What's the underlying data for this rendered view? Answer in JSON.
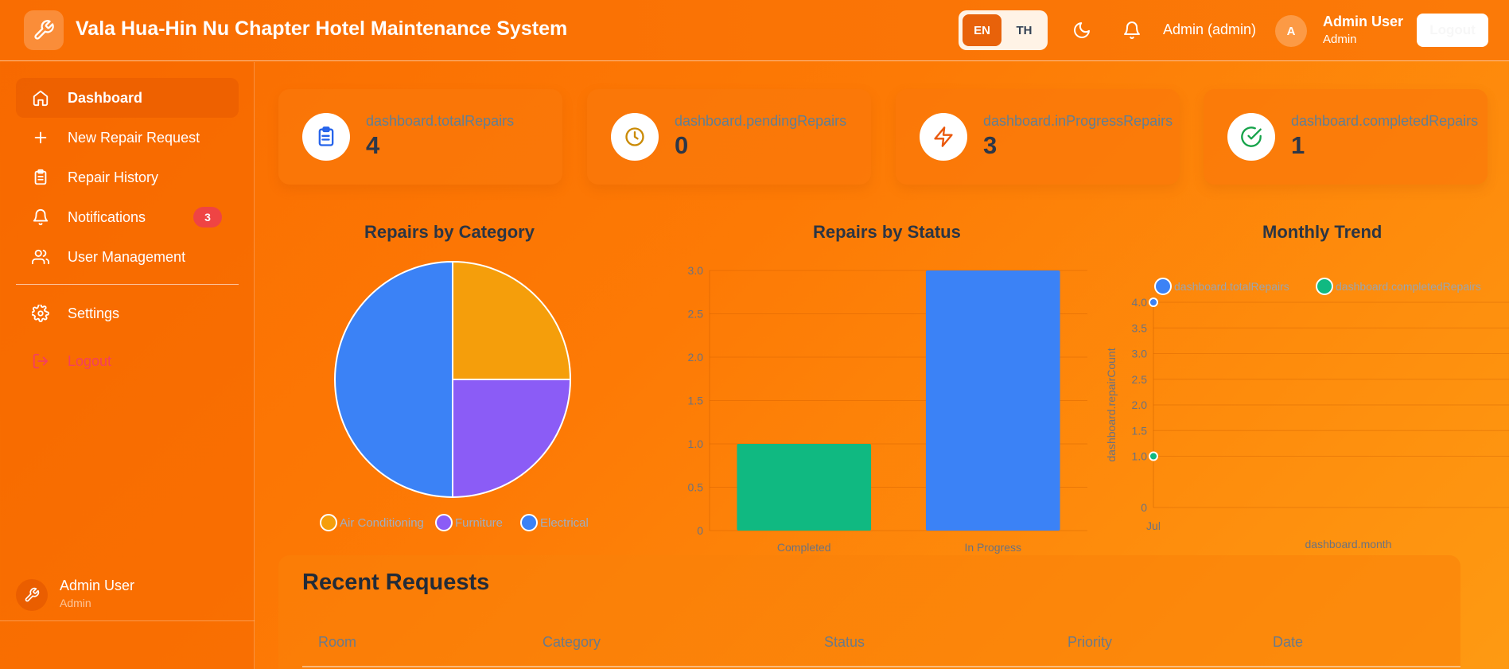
{
  "header": {
    "title": "Vala Hua-Hin Nu Chapter Hotel Maintenance System",
    "lang_en": "EN",
    "lang_th": "TH",
    "role_label": "Admin (admin)",
    "avatar_initial": "A",
    "user_name": "Admin User",
    "user_role": "Admin",
    "logout_label": "Logout"
  },
  "sidebar": {
    "items": [
      {
        "label": "Dashboard",
        "icon": "home-icon",
        "active": true
      },
      {
        "label": "New Repair Request",
        "icon": "plus-icon"
      },
      {
        "label": "Repair History",
        "icon": "clipboard-icon"
      },
      {
        "label": "Notifications",
        "icon": "bell-icon",
        "badge": "3"
      },
      {
        "label": "User Management",
        "icon": "users-icon"
      }
    ],
    "settings_label": "Settings",
    "logout_label": "Logout",
    "footer_name": "Admin User",
    "footer_role": "Admin"
  },
  "stats": [
    {
      "label": "dashboard.totalRepairs",
      "value": "4",
      "icon": "clipboard-list-icon",
      "color": "#2563eb"
    },
    {
      "label": "dashboard.pendingRepairs",
      "value": "0",
      "icon": "clock-icon",
      "color": "#ca8a04"
    },
    {
      "label": "dashboard.inProgressRepairs",
      "value": "3",
      "icon": "bolt-icon",
      "color": "#ea580c"
    },
    {
      "label": "dashboard.completedRepairs",
      "value": "1",
      "icon": "check-circle-icon",
      "color": "#16a34a"
    }
  ],
  "chart_data": [
    {
      "type": "pie",
      "title": "Repairs by Category",
      "categories": [
        "Air Conditioning",
        "Furniture",
        "Electrical"
      ],
      "values": [
        1,
        1,
        2
      ],
      "colors": [
        "#f59e0b",
        "#8b5cf6",
        "#3b82f6"
      ],
      "legend": "bottom"
    },
    {
      "type": "bar",
      "title": "Repairs by Status",
      "categories": [
        "Completed",
        "In Progress"
      ],
      "values": [
        1,
        3
      ],
      "colors": [
        "#10b981",
        "#3b82f6"
      ],
      "ylim": [
        0,
        3
      ],
      "yticks": [
        "0",
        "0.5",
        "1.0",
        "1.5",
        "2.0",
        "2.5",
        "3.0"
      ],
      "grid": true
    },
    {
      "type": "line",
      "title": "Monthly Trend",
      "xlabel": "dashboard.month",
      "ylabel": "dashboard.repairCount",
      "x": [
        "Jul"
      ],
      "series": [
        {
          "name": "dashboard.totalRepairs",
          "values": [
            4
          ],
          "color": "#3b82f6"
        },
        {
          "name": "dashboard.completedRepairs",
          "values": [
            1
          ],
          "color": "#10b981"
        }
      ],
      "ylim": [
        0,
        4
      ],
      "yticks": [
        "0",
        "1.0",
        "1.5",
        "2.0",
        "2.5",
        "3.0",
        "3.5",
        "4.0"
      ],
      "legend": "top",
      "grid": true
    }
  ],
  "recent": {
    "title": "Recent Requests",
    "columns": [
      "Room",
      "Category",
      "Status",
      "Priority",
      "Date"
    ]
  }
}
